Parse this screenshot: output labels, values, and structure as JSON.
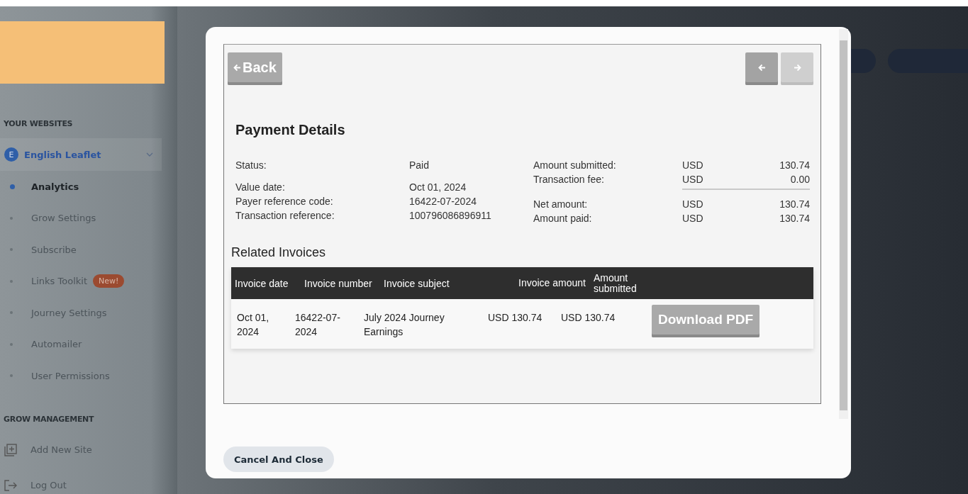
{
  "sidebar": {
    "sections": [
      {
        "heading": "YOUR WEBSITES",
        "site": {
          "initial": "E",
          "name": "English Leaflet",
          "expanded": true
        },
        "items": [
          {
            "label": "Analytics",
            "selected": true
          },
          {
            "label": "Grow Settings",
            "selected": false
          },
          {
            "label": "Subscribe",
            "selected": false
          },
          {
            "label": "Links Toolkit",
            "selected": false,
            "badge": "New!"
          },
          {
            "label": "Journey Settings",
            "selected": false
          },
          {
            "label": "Automailer",
            "selected": false
          },
          {
            "label": "User Permissions",
            "selected": false
          }
        ]
      },
      {
        "heading": "GROW MANAGEMENT",
        "actions": [
          {
            "kind": "add",
            "label": "Add New Site"
          },
          {
            "kind": "logout",
            "label": "Log Out"
          }
        ]
      }
    ]
  },
  "modal": {
    "back": "Back",
    "nav": [
      {
        "kind": "prev",
        "disabled": false
      },
      {
        "kind": "next",
        "disabled": true
      }
    ],
    "title": "Payment Details",
    "details": [
      {
        "label": "Status:",
        "value": "Paid"
      },
      {
        "label": "Value date:",
        "value": "Oct 01, 2024"
      },
      {
        "label": "Payer reference code:",
        "value": "16422-07-2024"
      },
      {
        "label": "Transaction reference:",
        "value": "100796086896911"
      }
    ],
    "amounts": [
      {
        "label": "Amount submitted:",
        "currency": "USD",
        "value": "130.74",
        "rule_after": false
      },
      {
        "label": "Transaction fee:",
        "currency": "USD",
        "value": "0.00",
        "rule_after": true
      },
      {
        "label": "Net amount:",
        "currency": "USD",
        "value": "130.74",
        "rule_after": false
      },
      {
        "label": "Amount paid:",
        "currency": "USD",
        "value": "130.74",
        "rule_after": false
      }
    ],
    "invoices": {
      "heading": "Related Invoices",
      "columns": [
        "Invoice date",
        "Invoice number",
        "Invoice subject",
        "Invoice amount",
        "Amount submitted"
      ],
      "rows": [
        {
          "cells": [
            "Oct 01, 2024",
            "16422-07-2024",
            "July 2024 Journey Earnings",
            "USD 130.74",
            "USD 130.74"
          ],
          "action": "Download PDF"
        }
      ]
    },
    "cancel": "Cancel And Close"
  }
}
